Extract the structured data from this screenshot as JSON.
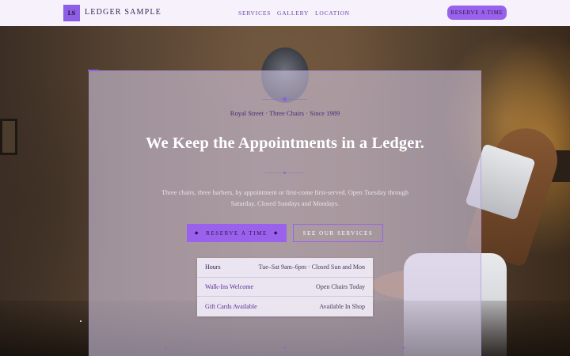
{
  "header": {
    "logo_mark": "LS",
    "logo_text": "LEDGER SAMPLE",
    "nav": [
      "SERVICES",
      "GALLERY",
      "LOCATION"
    ],
    "reserve_label": "RESERVE A TIME"
  },
  "hero": {
    "kicker": "Royal Street · Three Chairs · Since 1989",
    "headline": "We Keep the Appointments in a Ledger.",
    "lede": "Three chairs, three barbers, by appointment or first-come first-served. Open Tuesday through Saturday. Closed Sundays and Mondays.",
    "primary_cta": "RESERVE A TIME",
    "primary_cta_ornament": "◆",
    "secondary_cta": "SEE OUR SERVICES"
  },
  "info": [
    {
      "label": "Hours",
      "value": "Tue–Sat 9am–6pm · Closed Sun and Mon"
    },
    {
      "label": "Walk-Ins Welcome",
      "value": "Open Chairs Today"
    },
    {
      "label": "Gift Cards Available",
      "value": "Available In Shop"
    }
  ],
  "colors": {
    "accent": "#9a62ec",
    "header_bg": "#f6f1fb",
    "brand_text": "#3a2358"
  }
}
